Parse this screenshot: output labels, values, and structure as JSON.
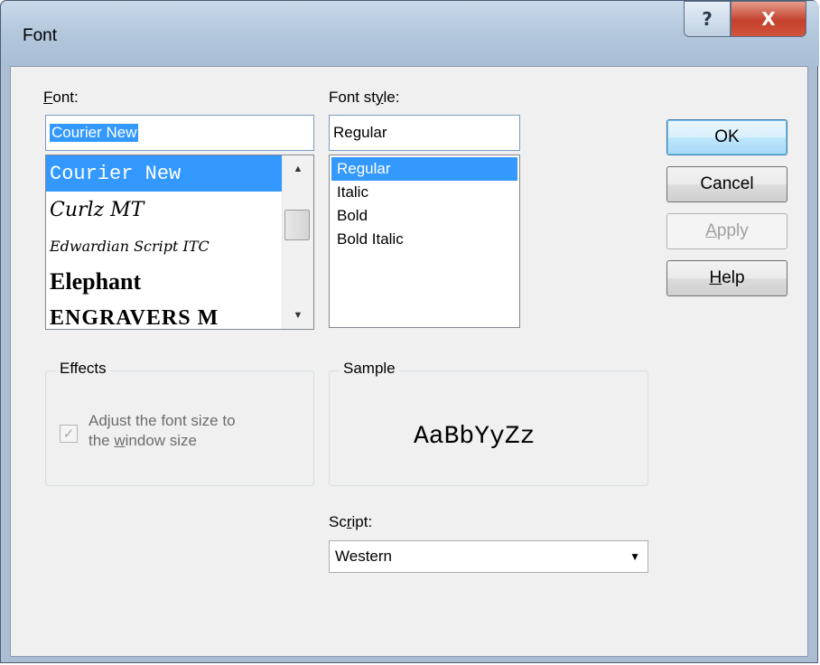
{
  "window": {
    "title": "Font",
    "help_glyph": "?",
    "close_glyph": "X"
  },
  "font": {
    "label": "Font:",
    "label_accel": "F",
    "label_rest": "ont:",
    "value": "Courier New",
    "items": [
      {
        "label": "Courier New",
        "selected": true
      },
      {
        "label": "Curlz MT",
        "selected": false
      },
      {
        "label": "Edwardian Script ITC",
        "selected": false
      },
      {
        "label": "Elephant",
        "selected": false
      },
      {
        "label": "ENGRAVERS M",
        "selected": false
      }
    ]
  },
  "font_style": {
    "label": "Font style:",
    "label_pre": "Font st",
    "label_accel": "y",
    "label_post": "le:",
    "value": "Regular",
    "items": [
      {
        "label": "Regular",
        "selected": true
      },
      {
        "label": "Italic",
        "selected": false
      },
      {
        "label": "Bold",
        "selected": false
      },
      {
        "label": "Bold Italic",
        "selected": false
      }
    ]
  },
  "buttons": {
    "ok": "OK",
    "cancel": "Cancel",
    "apply": "Apply",
    "apply_accel": "A",
    "apply_rest": "pply",
    "help": "Help",
    "help_accel": "H",
    "help_rest": "elp"
  },
  "effects": {
    "title": "Effects",
    "adjust_checked": true,
    "adjust_enabled": false,
    "adjust_line1": "Adjust the font size to",
    "adjust_line2_pre": "the ",
    "adjust_line2_accel": "w",
    "adjust_line2_post": "indow size"
  },
  "sample": {
    "title": "Sample",
    "text": "AaBbYyZz"
  },
  "script": {
    "label_pre": "Sc",
    "label_accel": "r",
    "label_post": "ipt:",
    "value": "Western"
  },
  "icons": [
    "help-icon",
    "close-icon",
    "scroll-up-icon",
    "scroll-down-icon",
    "dropdown-arrow-icon",
    "checkmark-icon"
  ]
}
